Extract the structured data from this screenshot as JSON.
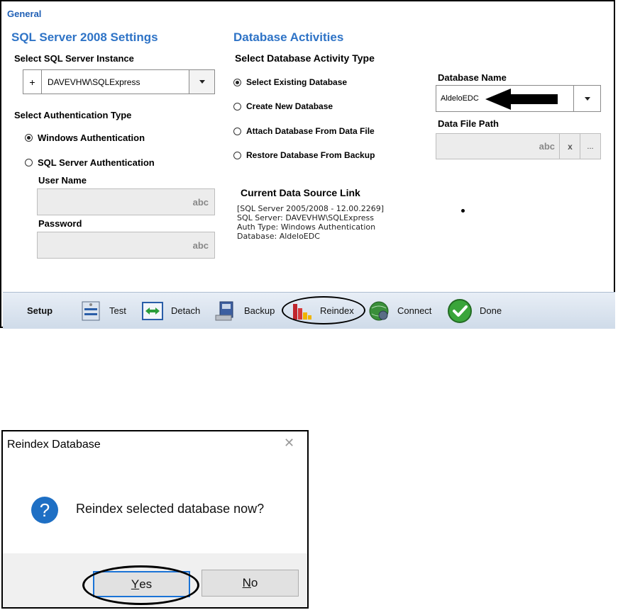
{
  "settings": {
    "group_label": "General",
    "sql_section_title": "SQL Server 2008 Settings",
    "instance_label": "Select SQL Server Instance",
    "instance_plus": "+",
    "instance_value": "DAVEVHW\\SQLExpress",
    "auth_label": "Select Authentication Type",
    "auth_options": [
      {
        "label": "Windows Authentication",
        "selected": true
      },
      {
        "label": "SQL Server Authentication",
        "selected": false
      }
    ],
    "username_label": "User Name",
    "username_hint": "abc",
    "password_label": "Password",
    "password_hint": "abc",
    "db_section_title": "Database Activities",
    "activity_label": "Select Database Activity Type",
    "activity_options": [
      {
        "label": "Select Existing Database",
        "selected": true
      },
      {
        "label": "Create New Database",
        "selected": false
      },
      {
        "label": "Attach Database From Data File",
        "selected": false
      },
      {
        "label": "Restore Database From Backup",
        "selected": false
      }
    ],
    "db_name_label": "Database Name",
    "db_name_value": "AldeloEDC",
    "data_file_label": "Data File Path",
    "data_file_hint": "abc",
    "data_file_clear": "x",
    "data_file_browse": "...",
    "link_title": "Current Data Source Link",
    "link_lines": [
      "[SQL Server 2005/2008 - 12.00.2269]",
      "SQL Server: DAVEVHW\\SQLExpress",
      "Auth Type: Windows Authentication",
      "Database: AldeloEDC"
    ]
  },
  "toolbar": {
    "group_label": "Setup",
    "test": "Test",
    "detach": "Detach",
    "backup": "Backup",
    "reindex": "Reindex",
    "connect": "Connect",
    "done": "Done"
  },
  "dialog": {
    "title": "Reindex Database",
    "close_glyph": "✕",
    "icon_glyph": "?",
    "message": "Reindex selected database now?",
    "yes_mnemonic": "Y",
    "yes_rest": "es",
    "no_mnemonic": "N",
    "no_rest": "o"
  },
  "colors": {
    "section_title": "#2e73c6",
    "group_label": "#1f5fb5",
    "question_icon": "#1e6fc4",
    "done_icon": "#3aa53a"
  }
}
